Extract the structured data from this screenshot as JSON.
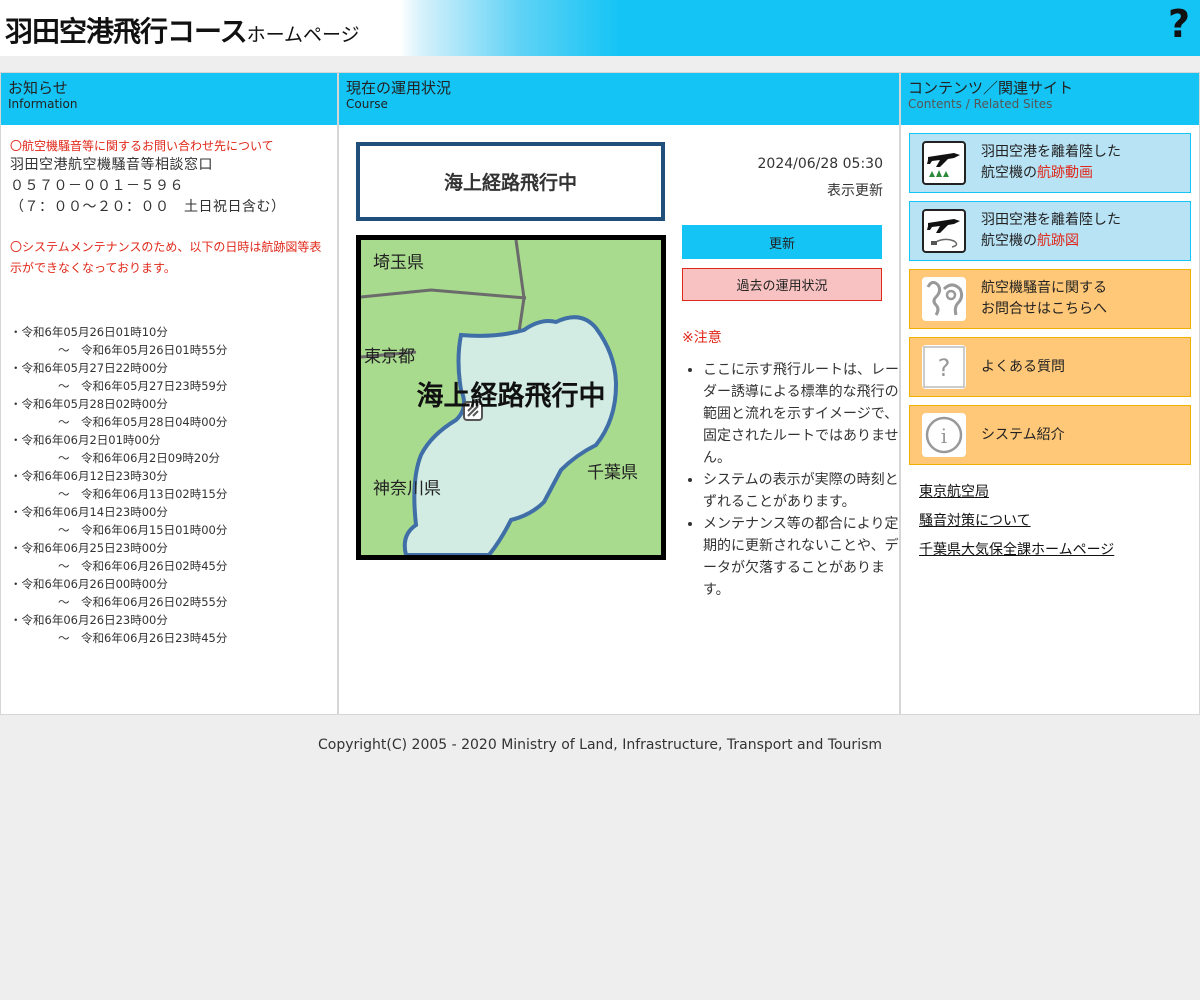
{
  "header": {
    "title_main": "羽田空港飛行コース",
    "title_sub": "ホームページ",
    "help_glyph": "?"
  },
  "info": {
    "heading": "お知らせ",
    "heading_en": "Information",
    "notice1": "〇航空機騒音等に関するお問い合わせ先について",
    "contact_name": "羽田空港航空機騒音等相談窓口",
    "contact_phone": "０５７０－００１－５９６",
    "contact_hours": "（７：００～２０：００　土日祝日含む）",
    "notice2": "〇システムメンテナンスのため、以下の日時は航跡図等表示ができなくなっております。",
    "schedule": [
      {
        "from": "・令和6年05月26日01時10分",
        "to": "～　令和6年05月26日01時55分"
      },
      {
        "from": "・令和6年05月27日22時00分",
        "to": "～　令和6年05月27日23時59分"
      },
      {
        "from": "・令和6年05月28日02時00分",
        "to": "～　令和6年05月28日04時00分"
      },
      {
        "from": "・令和6年06月2日01時00分",
        "to": "～　令和6年06月2日09時20分"
      },
      {
        "from": "・令和6年06月12日23時30分",
        "to": "～　令和6年06月13日02時15分"
      },
      {
        "from": "・令和6年06月14日23時00分",
        "to": "～　令和6年06月15日01時00分"
      },
      {
        "from": "・令和6年06月25日23時00分",
        "to": "～　令和6年06月26日02時45分"
      },
      {
        "from": "・令和6年06月26日00時00分",
        "to": "～　令和6年06月26日02時55分"
      },
      {
        "from": "・令和6年06月26日23時00分",
        "to": "～　令和6年06月26日23時45分"
      }
    ]
  },
  "course": {
    "heading": "現在の運用状況",
    "heading_en": "Course",
    "status": "海上経路飛行中",
    "map_overlay": "海上経路飛行中",
    "map_labels": {
      "saitama": "埼玉県",
      "tokyo": "東京都",
      "kanagawa": "神奈川県",
      "chiba": "千葉県"
    },
    "timestamp": "2024/06/28 05:30",
    "timestamp_label": "表示更新",
    "update_button": "更新",
    "past_button": "過去の運用状況",
    "caution_title": "※注意",
    "caution_items": [
      "ここに示す飛行ルートは、レーダー誘導による標準的な飛行の範囲と流れを示すイメージで、固定されたルートではありません。",
      "システムの表示が実際の時刻とずれることがあります。",
      "メンテナンス等の都合により定期的に更新されないことや、データが欠落することがあります。"
    ]
  },
  "contents": {
    "heading": "コンテンツ／関連サイト",
    "heading_en": "Contents / Related Sites",
    "buttons": [
      {
        "line1": "羽田空港を離着陸した",
        "line2_pre": "航空機の",
        "line2_hl": "航跡動画",
        "icon": "airplane-video-icon"
      },
      {
        "line1": "羽田空港を離着陸した",
        "line2_pre": "航空機の",
        "line2_hl": "航跡図",
        "icon": "airplane-map-icon"
      },
      {
        "line1": "航空機騒音に関する",
        "line2": "お問合せはこちらへ",
        "icon": "ear-icon"
      },
      {
        "line1": "よくある質問",
        "icon": "question-icon"
      },
      {
        "line1": "システム紹介",
        "icon": "info-icon"
      }
    ],
    "links": [
      "東京航空局",
      "騒音対策について",
      "千葉県大気保全課ホームページ"
    ]
  },
  "footer": {
    "copyright": "Copyright(C) 2005 - 2020 Ministry of Land, Infrastructure, Transport and Tourism"
  },
  "colors": {
    "accent_blue": "#14c4f5",
    "alert_red": "#e0281a",
    "button_orange": "#ffc878",
    "button_light_blue": "#b8e3f5",
    "map_land": "#a8db8e",
    "map_sea": "#d2ebe3",
    "status_border": "#1f4f7a"
  }
}
